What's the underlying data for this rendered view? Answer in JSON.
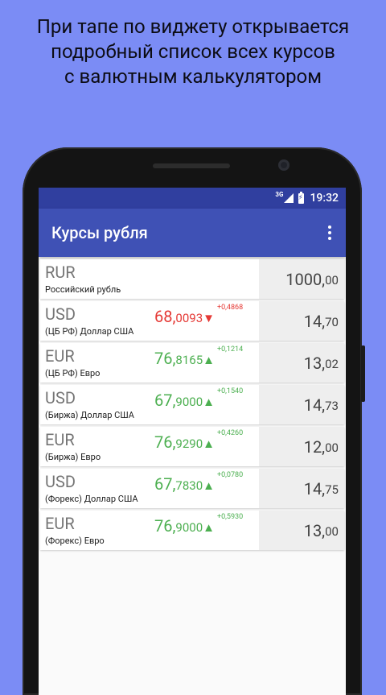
{
  "promo": {
    "line1": "При тапе по виджету открывается",
    "line2": "подробный список всех курсов",
    "line3": "с валютным калькулятором"
  },
  "status_bar": {
    "network": "3G",
    "time": "19:32"
  },
  "toolbar": {
    "title": "Курсы рубля",
    "menu_icon": "more-vert-icon"
  },
  "colors": {
    "background": "#7b8cf5",
    "status_bar": "#303f9f",
    "toolbar": "#3f51b5",
    "rate_up": "#4caf50",
    "rate_down": "#e53935"
  },
  "rows": [
    {
      "code": "RUR",
      "name": "Российский рубль",
      "rate_int": "",
      "rate_frac": "",
      "arrow": "",
      "delta": "",
      "trend": "",
      "amount_int": "1000,",
      "amount_frac": "00"
    },
    {
      "code": "USD",
      "name": "(ЦБ РФ) Доллар США",
      "rate_int": "68,",
      "rate_frac": "0093",
      "arrow": "▼",
      "delta": "+0,4868",
      "trend": "down",
      "amount_int": "14,",
      "amount_frac": "70"
    },
    {
      "code": "EUR",
      "name": "(ЦБ РФ) Евро",
      "rate_int": "76,",
      "rate_frac": "8165",
      "arrow": "▲",
      "delta": "+0,1214",
      "trend": "up",
      "amount_int": "13,",
      "amount_frac": "02"
    },
    {
      "code": "USD",
      "name": "(Биржа) Доллар США",
      "rate_int": "67,",
      "rate_frac": "9000",
      "arrow": "▲",
      "delta": "+0,1540",
      "trend": "up",
      "amount_int": "14,",
      "amount_frac": "73"
    },
    {
      "code": "EUR",
      "name": "(Биржа) Евро",
      "rate_int": "76,",
      "rate_frac": "9290",
      "arrow": "▲",
      "delta": "+0,4260",
      "trend": "up",
      "amount_int": "12,",
      "amount_frac": "00"
    },
    {
      "code": "USD",
      "name": "(Форекс) Доллар США",
      "rate_int": "67,",
      "rate_frac": "7830",
      "arrow": "▲",
      "delta": "+0,0780",
      "trend": "up",
      "amount_int": "14,",
      "amount_frac": "75"
    },
    {
      "code": "EUR",
      "name": "(Форекс) Евро",
      "rate_int": "76,",
      "rate_frac": "9000",
      "arrow": "▲",
      "delta": "+0,5930",
      "trend": "up",
      "amount_int": "13,",
      "amount_frac": "00"
    }
  ]
}
